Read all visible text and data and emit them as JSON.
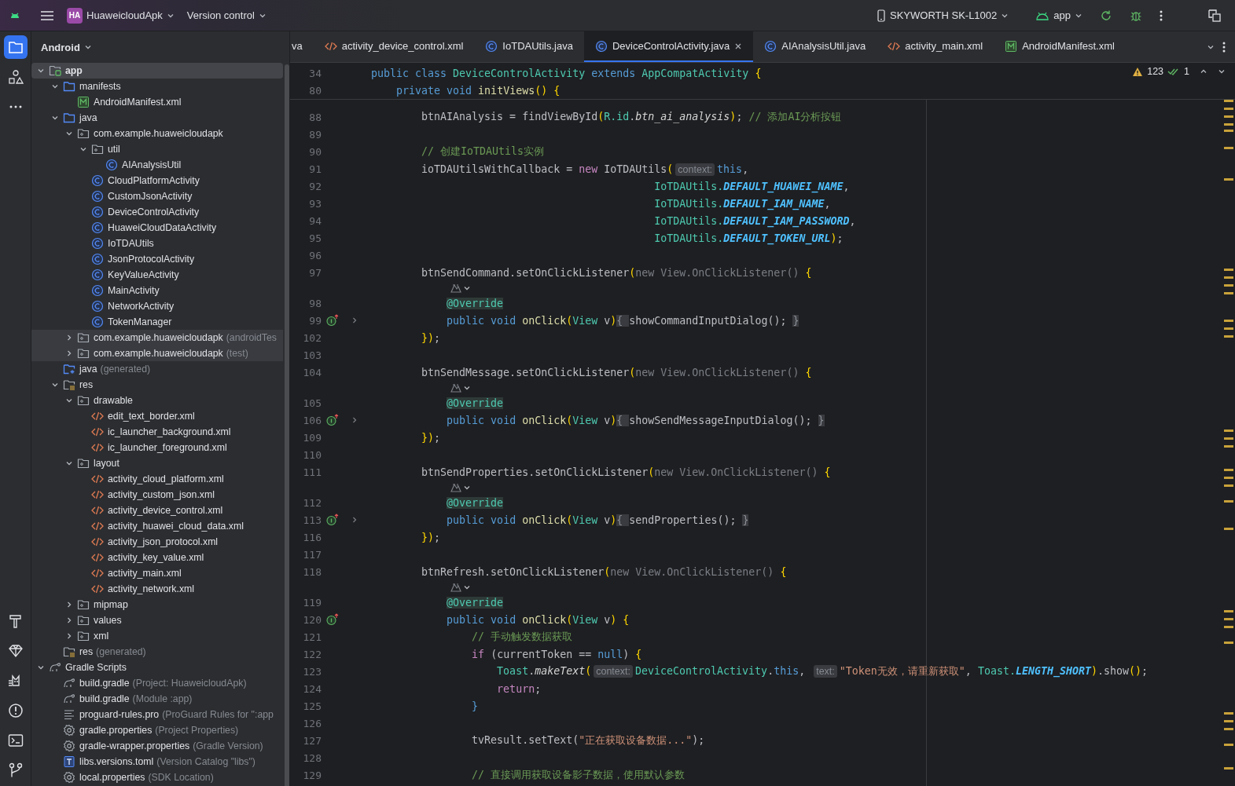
{
  "title_bar": {
    "project_badge": "HA",
    "project_name": "HuaweicloudApk",
    "vcs_menu": "Version control",
    "device": "SKYWORTH SK-L1002",
    "run_config": "app"
  },
  "project_panel": {
    "view_selector": "Android",
    "tree": [
      {
        "label": "app",
        "kind": "module",
        "expanded": true,
        "selected": true,
        "highlighted": false,
        "children": [
          {
            "label": "manifests",
            "kind": "folder",
            "expanded": true,
            "selected": false,
            "highlighted": false,
            "children": [
              {
                "label": "AndroidManifest.xml",
                "kind": "manifest",
                "selected": false,
                "highlighted": false
              }
            ]
          },
          {
            "label": "java",
            "kind": "folder",
            "expanded": true,
            "selected": false,
            "highlighted": false,
            "children": [
              {
                "label": "com.example.huaweicloudapk",
                "kind": "package",
                "expanded": true,
                "selected": false,
                "highlighted": false,
                "children": [
                  {
                    "label": "util",
                    "kind": "package",
                    "expanded": true,
                    "selected": false,
                    "highlighted": false,
                    "children": [
                      {
                        "label": "AIAnalysisUtil",
                        "kind": "class",
                        "selected": false,
                        "highlighted": false
                      }
                    ]
                  },
                  {
                    "label": "CloudPlatformActivity",
                    "kind": "class",
                    "selected": false,
                    "highlighted": false
                  },
                  {
                    "label": "CustomJsonActivity",
                    "kind": "class",
                    "selected": false,
                    "highlighted": false
                  },
                  {
                    "label": "DeviceControlActivity",
                    "kind": "class",
                    "selected": false,
                    "highlighted": false
                  },
                  {
                    "label": "HuaweiCloudDataActivity",
                    "kind": "class",
                    "selected": false,
                    "highlighted": false
                  },
                  {
                    "label": "IoTDAUtils",
                    "kind": "class",
                    "selected": false,
                    "highlighted": false
                  },
                  {
                    "label": "JsonProtocolActivity",
                    "kind": "class",
                    "selected": false,
                    "highlighted": false
                  },
                  {
                    "label": "KeyValueActivity",
                    "kind": "class",
                    "selected": false,
                    "highlighted": false
                  },
                  {
                    "label": "MainActivity",
                    "kind": "class",
                    "selected": false,
                    "highlighted": false
                  },
                  {
                    "label": "NetworkActivity",
                    "kind": "class",
                    "selected": false,
                    "highlighted": false
                  },
                  {
                    "label": "TokenManager",
                    "kind": "class",
                    "selected": false,
                    "highlighted": false
                  }
                ]
              },
              {
                "label": "com.example.huaweicloudapk",
                "suffix": "(androidTes",
                "kind": "package",
                "expanded": false,
                "selected": false,
                "highlighted": true
              },
              {
                "label": "com.example.huaweicloudapk",
                "suffix": "(test)",
                "kind": "package",
                "expanded": false,
                "selected": false,
                "highlighted": true
              }
            ]
          },
          {
            "label": "java",
            "suffix": "(generated)",
            "kind": "gen-folder",
            "selected": false,
            "highlighted": false
          },
          {
            "label": "res",
            "kind": "res-folder",
            "expanded": true,
            "selected": false,
            "highlighted": false,
            "children": [
              {
                "label": "drawable",
                "kind": "package",
                "expanded": true,
                "selected": false,
                "highlighted": false,
                "children": [
                  {
                    "label": "edit_text_border.xml",
                    "kind": "xml",
                    "selected": false,
                    "highlighted": false
                  },
                  {
                    "label": "ic_launcher_background.xml",
                    "kind": "xml",
                    "selected": false,
                    "highlighted": false
                  },
                  {
                    "label": "ic_launcher_foreground.xml",
                    "kind": "xml",
                    "selected": false,
                    "highlighted": false
                  }
                ]
              },
              {
                "label": "layout",
                "kind": "package",
                "expanded": true,
                "selected": false,
                "highlighted": false,
                "children": [
                  {
                    "label": "activity_cloud_platform.xml",
                    "kind": "xml",
                    "selected": false,
                    "highlighted": false
                  },
                  {
                    "label": "activity_custom_json.xml",
                    "kind": "xml",
                    "selected": false,
                    "highlighted": false
                  },
                  {
                    "label": "activity_device_control.xml",
                    "kind": "xml",
                    "selected": false,
                    "highlighted": false
                  },
                  {
                    "label": "activity_huawei_cloud_data.xml",
                    "kind": "xml",
                    "selected": false,
                    "highlighted": false
                  },
                  {
                    "label": "activity_json_protocol.xml",
                    "kind": "xml",
                    "selected": false,
                    "highlighted": false
                  },
                  {
                    "label": "activity_key_value.xml",
                    "kind": "xml",
                    "selected": false,
                    "highlighted": false
                  },
                  {
                    "label": "activity_main.xml",
                    "kind": "xml",
                    "selected": false,
                    "highlighted": false
                  },
                  {
                    "label": "activity_network.xml",
                    "kind": "xml",
                    "selected": false,
                    "highlighted": false
                  }
                ]
              },
              {
                "label": "mipmap",
                "kind": "package",
                "expanded": false,
                "selected": false,
                "highlighted": false
              },
              {
                "label": "values",
                "kind": "package",
                "expanded": false,
                "selected": false,
                "highlighted": false
              },
              {
                "label": "xml",
                "kind": "package",
                "expanded": false,
                "selected": false,
                "highlighted": false
              }
            ]
          },
          {
            "label": "res",
            "suffix": "(generated)",
            "kind": "res-folder",
            "selected": false,
            "highlighted": false
          }
        ]
      },
      {
        "label": "Gradle Scripts",
        "kind": "gradle",
        "expanded": true,
        "selected": false,
        "highlighted": false,
        "children": [
          {
            "label": "build.gradle",
            "suffix": "(Project: HuaweicloudApk)",
            "kind": "gradle",
            "selected": false,
            "highlighted": false
          },
          {
            "label": "build.gradle",
            "suffix": "(Module :app)",
            "kind": "gradle",
            "selected": false,
            "highlighted": false
          },
          {
            "label": "proguard-rules.pro",
            "suffix": "(ProGuard Rules for \":app",
            "kind": "text-file",
            "selected": false,
            "highlighted": false
          },
          {
            "label": "gradle.properties",
            "suffix": "(Project Properties)",
            "kind": "settings",
            "selected": false,
            "highlighted": false
          },
          {
            "label": "gradle-wrapper.properties",
            "suffix": "(Gradle Version)",
            "kind": "settings",
            "selected": false,
            "highlighted": false
          },
          {
            "label": "libs.versions.toml",
            "suffix": "(Version Catalog \"libs\")",
            "kind": "toml",
            "selected": false,
            "highlighted": false
          },
          {
            "label": "local.properties",
            "suffix": "(SDK Location)",
            "kind": "settings",
            "selected": false,
            "highlighted": false
          }
        ]
      }
    ]
  },
  "editor": {
    "tabs": [
      {
        "label": "va",
        "selected": false
      },
      {
        "label": "activity_device_control.xml",
        "kind": "xml",
        "selected": false
      },
      {
        "label": "IoTDAUtils.java",
        "kind": "class",
        "selected": false
      },
      {
        "label": "DeviceControlActivity.java",
        "kind": "class",
        "selected": true
      },
      {
        "label": "AIAnalysisUtil.java",
        "kind": "class",
        "selected": false
      },
      {
        "label": "activity_main.xml",
        "kind": "xml",
        "selected": false
      },
      {
        "label": "AndroidManifest.xml",
        "kind": "manifest",
        "selected": false
      }
    ],
    "inspections": {
      "warnings": "123",
      "passed": "1"
    },
    "sticky_lines": [
      {
        "number": "34",
        "tokens": [
          {
            "kind": "keyword",
            "text": "public class "
          },
          {
            "kind": "type",
            "text": "DeviceControlActivity"
          },
          {
            "kind": "keyword",
            "text": " extends "
          },
          {
            "kind": "type",
            "text": "AppCompatActivity"
          },
          {
            "kind": "brace",
            "text": " {"
          }
        ]
      },
      {
        "number": "80",
        "tokens": [
          {
            "kind": "keyword",
            "text": "    private void "
          },
          {
            "kind": "method",
            "text": "initViews"
          },
          {
            "kind": "brace",
            "text": "() {"
          }
        ]
      }
    ],
    "lines": [
      {
        "kind": "code",
        "number": "88",
        "tokens": [
          {
            "kind": "plain",
            "text": "        btnAIAnalysis = findViewById"
          },
          {
            "kind": "brace",
            "text": "("
          },
          {
            "kind": "type",
            "text": "R.id"
          },
          {
            "kind": "plain",
            "text": "."
          },
          {
            "kind": "italic",
            "text": "btn_ai_analysis"
          },
          {
            "kind": "brace",
            "text": ")"
          },
          {
            "kind": "plain",
            "text": "; "
          },
          {
            "kind": "comment",
            "text": "// 添加AI分析按钮"
          }
        ]
      },
      {
        "kind": "code",
        "number": "89"
      },
      {
        "kind": "code",
        "number": "90",
        "tokens": [
          {
            "kind": "comment",
            "text": "        // 创建IoTDAUtils实例"
          }
        ]
      },
      {
        "kind": "code",
        "number": "91",
        "tokens": [
          {
            "kind": "plain",
            "text": "        ioTDAUtilsWithCallback = "
          },
          {
            "kind": "control",
            "text": "new"
          },
          {
            "kind": "plain",
            "text": " IoTDAUtils"
          },
          {
            "kind": "brace",
            "text": "("
          },
          {
            "kind": "hint",
            "text": "context:"
          },
          {
            "kind": "keyword",
            "text": "this"
          },
          {
            "kind": "plain",
            "text": ","
          }
        ]
      },
      {
        "kind": "code",
        "number": "92",
        "tokens": [
          {
            "kind": "type",
            "text": "                                             IoTDAUtils."
          },
          {
            "kind": "const",
            "text": "DEFAULT_HUAWEI_NAME"
          },
          {
            "kind": "plain",
            "text": ","
          }
        ]
      },
      {
        "kind": "code",
        "number": "93",
        "tokens": [
          {
            "kind": "type",
            "text": "                                             IoTDAUtils."
          },
          {
            "kind": "const",
            "text": "DEFAULT_IAM_NAME"
          },
          {
            "kind": "plain",
            "text": ","
          }
        ]
      },
      {
        "kind": "code",
        "number": "94",
        "tokens": [
          {
            "kind": "type",
            "text": "                                             IoTDAUtils."
          },
          {
            "kind": "const",
            "text": "DEFAULT_IAM_PASSWORD"
          },
          {
            "kind": "plain",
            "text": ","
          }
        ]
      },
      {
        "kind": "code",
        "number": "95",
        "tokens": [
          {
            "kind": "type",
            "text": "                                             IoTDAUtils."
          },
          {
            "kind": "const",
            "text": "DEFAULT_TOKEN_URL"
          },
          {
            "kind": "brace",
            "text": ")"
          },
          {
            "kind": "plain",
            "text": ";"
          }
        ]
      },
      {
        "kind": "code",
        "number": "96"
      },
      {
        "kind": "code",
        "number": "97",
        "tokens": [
          {
            "kind": "plain",
            "text": "        btnSendCommand.setOnClickListener"
          },
          {
            "kind": "brace",
            "text": "("
          },
          {
            "kind": "gray",
            "text": "new View.OnClickListener() "
          },
          {
            "kind": "brace",
            "text": "{"
          }
        ]
      },
      {
        "kind": "inlay"
      },
      {
        "kind": "code",
        "number": "98",
        "tokens": [
          {
            "kind": "annotation",
            "text": "            @Override"
          }
        ]
      },
      {
        "kind": "code",
        "number": "99",
        "gutter": [
          {
            "kind": "override"
          },
          {
            "kind": "fold"
          }
        ],
        "tokens": [
          {
            "kind": "keyword",
            "text": "            public void "
          },
          {
            "kind": "method",
            "text": "onClick"
          },
          {
            "kind": "brace",
            "text": "("
          },
          {
            "kind": "type",
            "text": "View"
          },
          {
            "kind": "plain",
            "text": " v"
          },
          {
            "kind": "brace",
            "text": ")"
          },
          {
            "kind": "fold",
            "text": "{ "
          },
          {
            "kind": "plain",
            "text": "showCommandInputDialog();"
          },
          {
            "kind": "fold",
            "text": " }"
          }
        ]
      },
      {
        "kind": "code",
        "number": "102",
        "tokens": [
          {
            "kind": "brace",
            "text": "        })"
          },
          {
            "kind": "plain",
            "text": ";"
          }
        ]
      },
      {
        "kind": "code",
        "number": "103"
      },
      {
        "kind": "code",
        "number": "104",
        "tokens": [
          {
            "kind": "plain",
            "text": "        btnSendMessage.setOnClickListener"
          },
          {
            "kind": "brace",
            "text": "("
          },
          {
            "kind": "gray",
            "text": "new View.OnClickListener() "
          },
          {
            "kind": "brace",
            "text": "{"
          }
        ]
      },
      {
        "kind": "inlay"
      },
      {
        "kind": "code",
        "number": "105",
        "tokens": [
          {
            "kind": "annotation",
            "text": "            @Override"
          }
        ]
      },
      {
        "kind": "code",
        "number": "106",
        "gutter": [
          {
            "kind": "override"
          },
          {
            "kind": "fold"
          }
        ],
        "tokens": [
          {
            "kind": "keyword",
            "text": "            public void "
          },
          {
            "kind": "method",
            "text": "onClick"
          },
          {
            "kind": "brace",
            "text": "("
          },
          {
            "kind": "type",
            "text": "View"
          },
          {
            "kind": "plain",
            "text": " v"
          },
          {
            "kind": "brace",
            "text": ")"
          },
          {
            "kind": "fold",
            "text": "{ "
          },
          {
            "kind": "plain",
            "text": "showSendMessageInputDialog();"
          },
          {
            "kind": "fold",
            "text": " }"
          }
        ]
      },
      {
        "kind": "code",
        "number": "109",
        "tokens": [
          {
            "kind": "brace",
            "text": "        })"
          },
          {
            "kind": "plain",
            "text": ";"
          }
        ]
      },
      {
        "kind": "code",
        "number": "110"
      },
      {
        "kind": "code",
        "number": "111",
        "tokens": [
          {
            "kind": "plain",
            "text": "        btnSendProperties.setOnClickListener"
          },
          {
            "kind": "brace",
            "text": "("
          },
          {
            "kind": "gray",
            "text": "new View.OnClickListener() "
          },
          {
            "kind": "brace",
            "text": "{"
          }
        ]
      },
      {
        "kind": "inlay"
      },
      {
        "kind": "code",
        "number": "112",
        "tokens": [
          {
            "kind": "annotation",
            "text": "            @Override"
          }
        ]
      },
      {
        "kind": "code",
        "number": "113",
        "gutter": [
          {
            "kind": "override"
          },
          {
            "kind": "fold"
          }
        ],
        "tokens": [
          {
            "kind": "keyword",
            "text": "            public void "
          },
          {
            "kind": "method",
            "text": "onClick"
          },
          {
            "kind": "brace",
            "text": "("
          },
          {
            "kind": "type",
            "text": "View"
          },
          {
            "kind": "plain",
            "text": " v"
          },
          {
            "kind": "brace",
            "text": ")"
          },
          {
            "kind": "fold",
            "text": "{ "
          },
          {
            "kind": "plain",
            "text": "sendProperties();"
          },
          {
            "kind": "fold",
            "text": " }"
          }
        ]
      },
      {
        "kind": "code",
        "number": "116",
        "tokens": [
          {
            "kind": "brace",
            "text": "        })"
          },
          {
            "kind": "plain",
            "text": ";"
          }
        ]
      },
      {
        "kind": "code",
        "number": "117"
      },
      {
        "kind": "code",
        "number": "118",
        "tokens": [
          {
            "kind": "plain",
            "text": "        btnRefresh.setOnClickListener"
          },
          {
            "kind": "brace",
            "text": "("
          },
          {
            "kind": "gray",
            "text": "new View.OnClickListener() "
          },
          {
            "kind": "brace",
            "text": "{"
          }
        ]
      },
      {
        "kind": "inlay"
      },
      {
        "kind": "code",
        "number": "119",
        "tokens": [
          {
            "kind": "annotation",
            "text": "            @Override"
          }
        ]
      },
      {
        "kind": "code",
        "number": "120",
        "gutter": [
          {
            "kind": "override"
          }
        ],
        "tokens": [
          {
            "kind": "keyword",
            "text": "            public void "
          },
          {
            "kind": "method",
            "text": "onClick"
          },
          {
            "kind": "brace",
            "text": "("
          },
          {
            "kind": "type",
            "text": "View"
          },
          {
            "kind": "plain",
            "text": " v"
          },
          {
            "kind": "brace",
            "text": ") {"
          }
        ]
      },
      {
        "kind": "code",
        "number": "121",
        "tokens": [
          {
            "kind": "comment",
            "text": "                // 手动触发数据获取"
          }
        ]
      },
      {
        "kind": "code",
        "number": "122",
        "tokens": [
          {
            "kind": "control",
            "text": "                if"
          },
          {
            "kind": "plain",
            "text": " (currentToken == "
          },
          {
            "kind": "keyword",
            "text": "null"
          },
          {
            "kind": "plain",
            "text": ") "
          },
          {
            "kind": "brace",
            "text": "{"
          }
        ]
      },
      {
        "kind": "code",
        "number": "123",
        "tokens": [
          {
            "kind": "type",
            "text": "                    Toast"
          },
          {
            "kind": "plain",
            "text": "."
          },
          {
            "kind": "italic",
            "text": "makeText"
          },
          {
            "kind": "brace",
            "text": "("
          },
          {
            "kind": "hint",
            "text": "context:"
          },
          {
            "kind": "type",
            "text": "DeviceControlActivity"
          },
          {
            "kind": "plain",
            "text": "."
          },
          {
            "kind": "keyword",
            "text": "this"
          },
          {
            "kind": "plain",
            "text": ", "
          },
          {
            "kind": "hint",
            "text": "text:"
          },
          {
            "kind": "string",
            "text": "\"Token无效，请重新获取\""
          },
          {
            "kind": "plain",
            "text": ", "
          },
          {
            "kind": "type",
            "text": "Toast."
          },
          {
            "kind": "const",
            "text": "LENGTH_SHORT"
          },
          {
            "kind": "brace",
            "text": ")"
          },
          {
            "kind": "plain",
            "text": ".show"
          },
          {
            "kind": "brace",
            "text": "()"
          },
          {
            "kind": "plain",
            "text": ";"
          }
        ]
      },
      {
        "kind": "code",
        "number": "124",
        "tokens": [
          {
            "kind": "control",
            "text": "                    return"
          },
          {
            "kind": "plain",
            "text": ";"
          }
        ]
      },
      {
        "kind": "code",
        "number": "125",
        "tokens": [
          {
            "kind": "keyword",
            "text": "                }"
          }
        ]
      },
      {
        "kind": "code",
        "number": "126"
      },
      {
        "kind": "code",
        "number": "127",
        "tokens": [
          {
            "kind": "plain",
            "text": "                tvResult.setText("
          },
          {
            "kind": "string",
            "text": "\"正在获取设备数据...\""
          },
          {
            "kind": "plain",
            "text": ");"
          }
        ]
      },
      {
        "kind": "code",
        "number": "128"
      },
      {
        "kind": "code",
        "number": "129",
        "tokens": [
          {
            "kind": "comment",
            "text": "                // 直接调用获取设备影子数据，使用默认参数"
          }
        ]
      }
    ]
  }
}
